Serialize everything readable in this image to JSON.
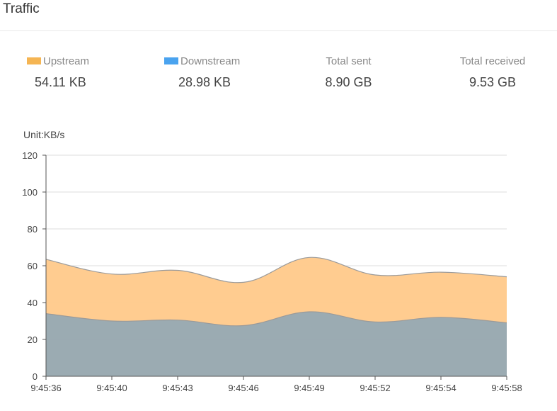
{
  "panel": {
    "title": "Traffic"
  },
  "stats": {
    "upstream": {
      "label": "Upstream",
      "value": "54.11 KB",
      "color": "#f5b553"
    },
    "downstream": {
      "label": "Downstream",
      "value": "28.98 KB",
      "color": "#4aa3ef"
    },
    "total_sent": {
      "label": "Total sent",
      "value": "8.90 GB"
    },
    "total_received": {
      "label": "Total received",
      "value": "9.53 GB"
    }
  },
  "chart_data": {
    "type": "area",
    "unit_label": "Unit:KB/s",
    "x": [
      "9:45:36",
      "9:45:40",
      "9:45:43",
      "9:45:46",
      "9:45:49",
      "9:45:52",
      "9:45:54",
      "9:45:58"
    ],
    "series": [
      {
        "name": "Upstream",
        "values": [
          63.5,
          55.5,
          57.5,
          51,
          64.5,
          55,
          56.5,
          54
        ],
        "color": "#ffc98a"
      },
      {
        "name": "Downstream",
        "values": [
          34,
          30,
          30.5,
          27.5,
          35,
          29.5,
          32,
          29
        ],
        "color": "#8aa4b8"
      }
    ],
    "y_ticks": [
      0,
      20,
      40,
      60,
      80,
      100,
      120
    ],
    "ylim": [
      0,
      120
    ],
    "grid": true
  }
}
